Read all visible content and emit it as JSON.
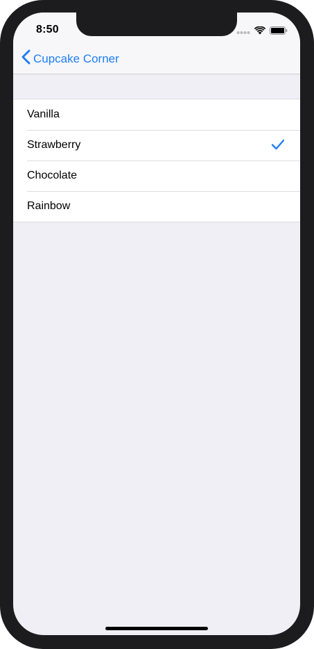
{
  "status_bar": {
    "time": "8:50",
    "icons": [
      "cellular-dots-icon",
      "wifi-icon",
      "battery-icon"
    ]
  },
  "nav": {
    "back_label": "Cupcake Corner",
    "back_icon": "chevron-left-icon"
  },
  "list": {
    "items": [
      {
        "label": "Vanilla",
        "selected": false
      },
      {
        "label": "Strawberry",
        "selected": true
      },
      {
        "label": "Chocolate",
        "selected": false
      },
      {
        "label": "Rainbow",
        "selected": false
      }
    ]
  },
  "colors": {
    "accent": "#1f7ef6",
    "background": "#f0eff5",
    "cell": "#ffffff"
  }
}
